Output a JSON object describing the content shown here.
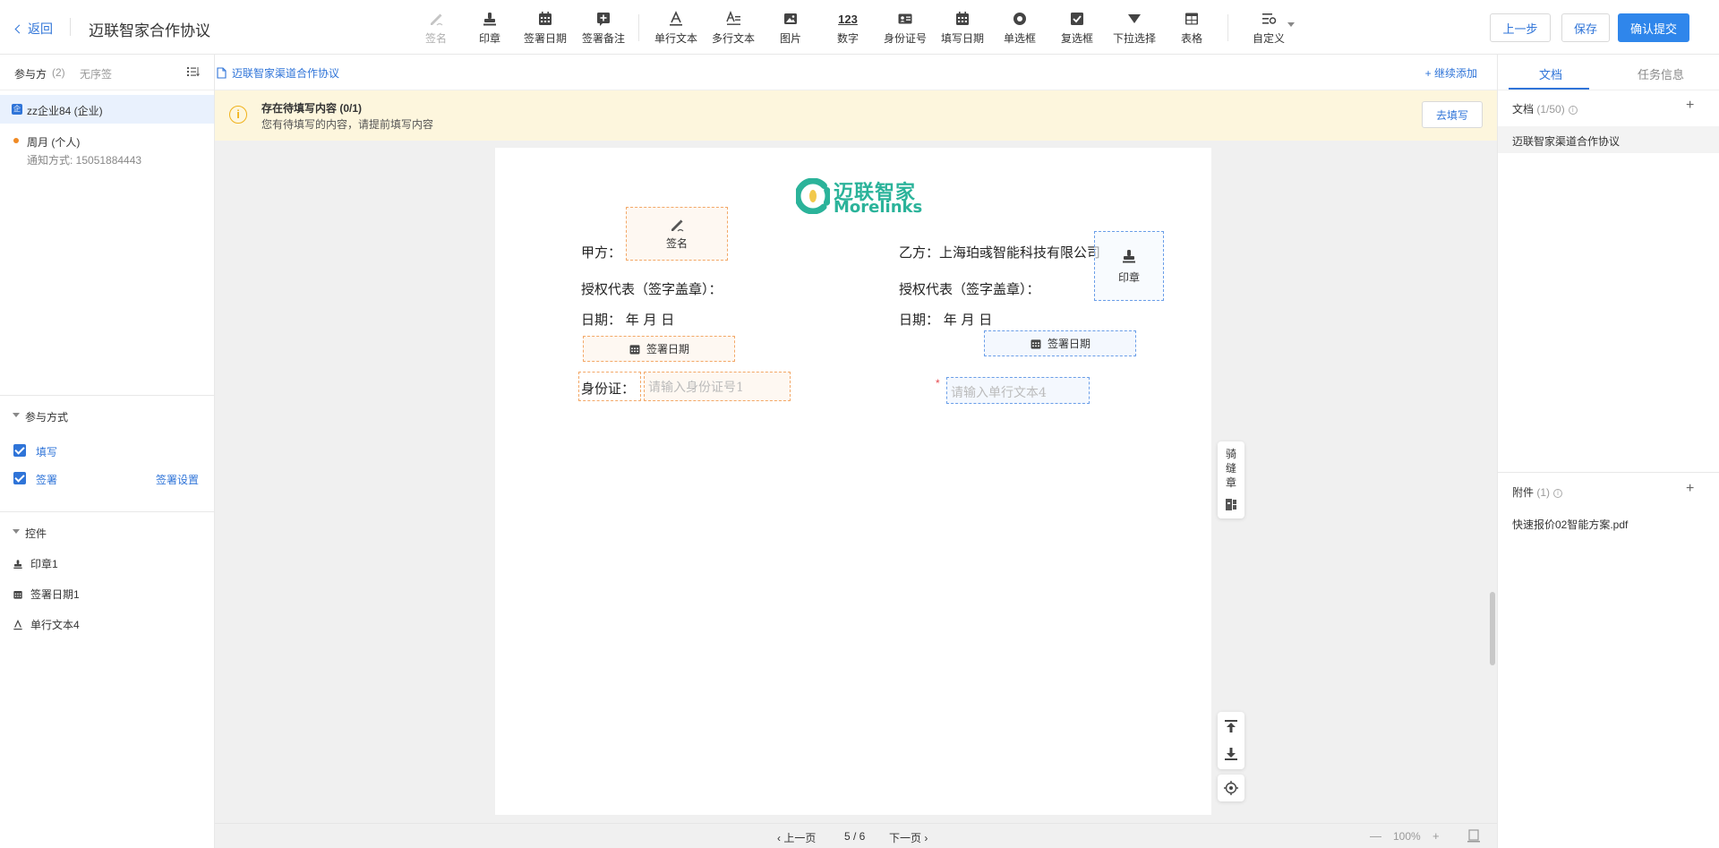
{
  "topbar": {
    "back_label": "返回",
    "doc_title": "迈联智家合作协议",
    "tools": [
      {
        "label": "签名",
        "icon": "pen-icon",
        "disabled": true
      },
      {
        "label": "印章",
        "icon": "stamp-icon"
      },
      {
        "label": "签署日期",
        "icon": "calendar-icon"
      },
      {
        "label": "签署备注",
        "icon": "note-plus-icon"
      },
      {
        "label": "单行文本",
        "icon": "single-text-icon"
      },
      {
        "label": "多行文本",
        "icon": "multi-text-icon"
      },
      {
        "label": "图片",
        "icon": "image-icon"
      },
      {
        "label": "数字",
        "icon": "number-icon",
        "glyph": "123"
      },
      {
        "label": "身份证号",
        "icon": "id-card-icon"
      },
      {
        "label": "填写日期",
        "icon": "calendar-icon"
      },
      {
        "label": "单选框",
        "icon": "radio-icon"
      },
      {
        "label": "复选框",
        "icon": "checkbox-icon"
      },
      {
        "label": "下拉选择",
        "icon": "dropdown-icon"
      },
      {
        "label": "表格",
        "icon": "table-icon"
      },
      {
        "label": "自定义",
        "icon": "custom-icon"
      }
    ],
    "prev_label": "上一步",
    "save_label": "保存",
    "submit_label": "确认提交"
  },
  "left": {
    "participants_title": "参与方",
    "participants_count": "(2)",
    "unordered_label": "无序签",
    "party1": "zz企业84 (企业)",
    "party2_name": "周月 (个人)",
    "party2_notice": "通知方式: 15051884443",
    "method_title": "参与方式",
    "fill_label": "填写",
    "sign_label": "签署",
    "sign_settings": "签署设置",
    "controls_title": "控件",
    "controls": [
      "印章1",
      "签署日期1",
      "单行文本4"
    ]
  },
  "center": {
    "crumb": "迈联智家渠道合作协议",
    "add_more": "+ 继续添加",
    "notice_title": "存在待填写内容 (0/1)",
    "notice_desc": "您有待填写的内容，请提前填写内容",
    "fill_btn": "去填写",
    "paper": {
      "logo_cn": "迈联智家",
      "logo_en": "Morelinks",
      "party_a": "甲方：",
      "party_b": "乙方：上海珀彧智能科技有限公司",
      "rep_a": "授权代表（签字盖章）：",
      "rep_b": "授权代表（签字盖章）：",
      "date_a": "日期：   年     月     日",
      "date_b": "日期：       年        月         日",
      "field_sign": "签名",
      "field_stamp": "印章",
      "field_date_a": "签署日期",
      "field_date_b": "签署日期",
      "id_label": "身份证：",
      "id_placeholder": "请输入身份证号1",
      "text_placeholder": "请输入单行文本4",
      "required_mark": "*"
    },
    "seam_label": "骑缝章",
    "pager": {
      "prev": "上一页",
      "page": "5 / 6",
      "next": "下一页",
      "zoom": "100%",
      "minus": "—",
      "plus": "+"
    }
  },
  "right": {
    "tab_docs": "文档",
    "tab_task": "任务信息",
    "docs_title": "文档",
    "docs_count": "(1/50)",
    "doc_item": "迈联智家渠道合作协议",
    "attach_title": "附件",
    "attach_count": "(1)",
    "attach_item": "快速报价02智能方案.pdf",
    "plus": "+"
  },
  "colors": {
    "accent": "#2f74d8",
    "primary_btn": "#2f86eb",
    "notice_bg": "#fdf6dd",
    "orange_field": "#f3a867",
    "blue_field": "#6a9ee8",
    "logo_green": "#2bb39a"
  }
}
